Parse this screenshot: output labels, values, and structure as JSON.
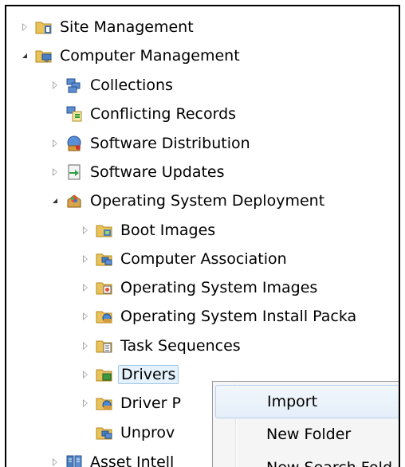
{
  "tree": {
    "items": [
      {
        "label": "Site Management",
        "icon": "site-management-icon",
        "state": "closed"
      },
      {
        "label": "Computer Management",
        "icon": "computer-management-icon",
        "state": "open"
      },
      {
        "label": "Collections",
        "icon": "collections-icon",
        "state": "closed"
      },
      {
        "label": "Conflicting Records",
        "icon": "conflicting-records-icon",
        "state": "none"
      },
      {
        "label": "Software Distribution",
        "icon": "software-distribution-icon",
        "state": "closed"
      },
      {
        "label": "Software Updates",
        "icon": "software-updates-icon",
        "state": "closed"
      },
      {
        "label": "Operating System Deployment",
        "icon": "operating-system-deployment-icon",
        "state": "open"
      },
      {
        "label": "Boot Images",
        "icon": "folder-icon",
        "state": "closed"
      },
      {
        "label": "Computer Association",
        "icon": "folder-icon",
        "state": "closed"
      },
      {
        "label": "Operating System Images",
        "icon": "folder-icon",
        "state": "closed"
      },
      {
        "label": "Operating System Install Packa",
        "icon": "folder-icon",
        "state": "closed"
      },
      {
        "label": "Task Sequences",
        "icon": "folder-icon",
        "state": "closed"
      },
      {
        "label": "Drivers",
        "icon": "folder-icon",
        "state": "closed",
        "selected": true
      },
      {
        "label": "Driver P",
        "icon": "folder-icon",
        "state": "closed"
      },
      {
        "label": "Unprov",
        "icon": "folder-icon",
        "state": "none"
      },
      {
        "label": "Asset Intell",
        "icon": "asset-intelligence-icon",
        "state": "closed"
      }
    ]
  },
  "context_menu": {
    "items": [
      {
        "label": "Import",
        "highlighted": true
      },
      {
        "label": "New Folder"
      },
      {
        "label": "New Search Fold"
      }
    ]
  },
  "colors": {
    "folder": "#e9c25a",
    "selection": "#e5f1fb",
    "selection_border": "#9fc7ec",
    "menu_bg": "#f5f5f5"
  }
}
